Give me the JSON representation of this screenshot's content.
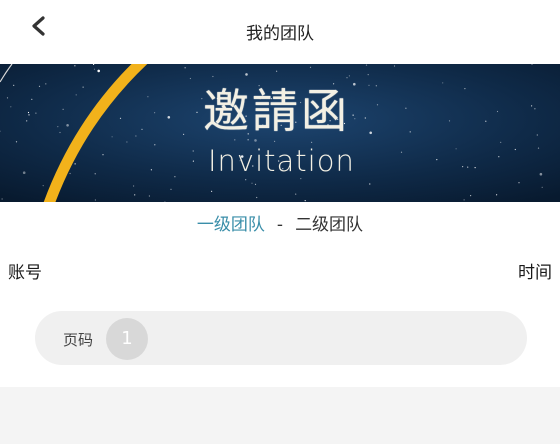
{
  "header": {
    "title": "我的团队",
    "back_icon": "chevron-left-icon"
  },
  "banner": {
    "title_cn": "邀請函",
    "title_en": "Invitation",
    "background_color": "#0f2a48",
    "accent_color": "#f2b21b"
  },
  "tabs": [
    {
      "label": "一级团队",
      "active": true
    },
    {
      "label": "二级团队",
      "active": false
    }
  ],
  "tab_separator": "-",
  "table": {
    "columns": [
      "账号",
      "时间"
    ]
  },
  "pagination": {
    "label": "页码",
    "pages": [
      "1"
    ]
  },
  "colors": {
    "active_tab": "#3a8ea9",
    "page_background": "#f4f4f4"
  }
}
